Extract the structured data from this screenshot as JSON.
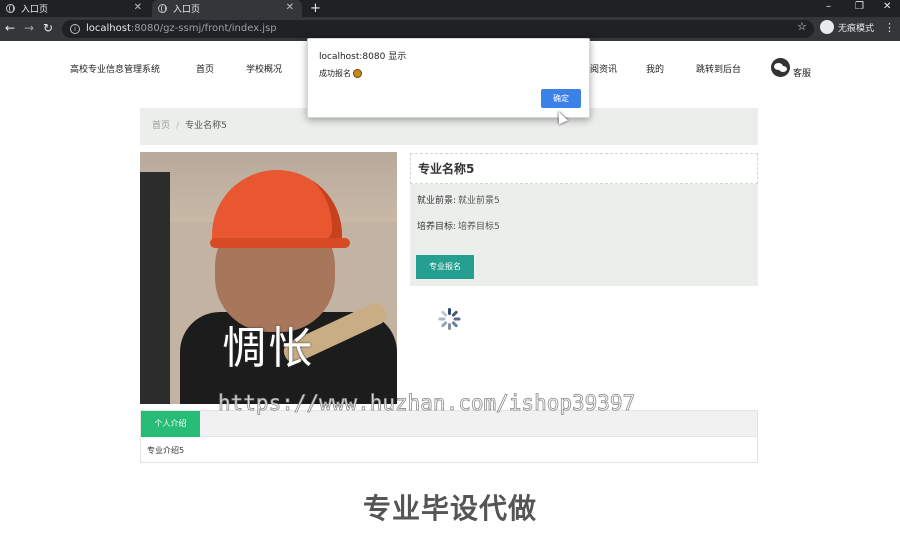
{
  "browser": {
    "tabs": [
      {
        "title": "入口页"
      },
      {
        "title": "入口页"
      }
    ],
    "new_tab": "+",
    "url_host": "localhost",
    "url_rest": ":8080/gz-ssmj/front/index.jsp",
    "incognito_label": "无痕模式",
    "win_min": "–",
    "win_max": "❐",
    "win_close": "✕"
  },
  "header": {
    "site_name": "高校专业信息管理系统",
    "nav": [
      "首页",
      "学校概况",
      "阅资讯",
      "我的",
      "跳转到后台"
    ],
    "service_label": "客服"
  },
  "breadcrumb": {
    "home": "首页",
    "separator": "/",
    "current": "专业名称5"
  },
  "photo": {
    "caption": "惆怅"
  },
  "detail": {
    "title": "专业名称5",
    "prospect_label": "就业前景:",
    "prospect_value": "就业前景5",
    "goal_label": "培养目标:",
    "goal_value": "培养目标5",
    "enroll_button": "专业报名"
  },
  "tabs": {
    "active": "个人介绍",
    "content": "专业介绍5"
  },
  "watermark": "https://www.huzhan.com/ishop39397",
  "bottom_text": "专业毕设代做",
  "alert": {
    "title": "localhost:8080 显示",
    "message": "成功报名",
    "ok_label": "确定"
  },
  "colors": {
    "enroll_button": "#259f8f",
    "active_tab": "#27bd77",
    "alert_ok": "#3b82e8"
  }
}
